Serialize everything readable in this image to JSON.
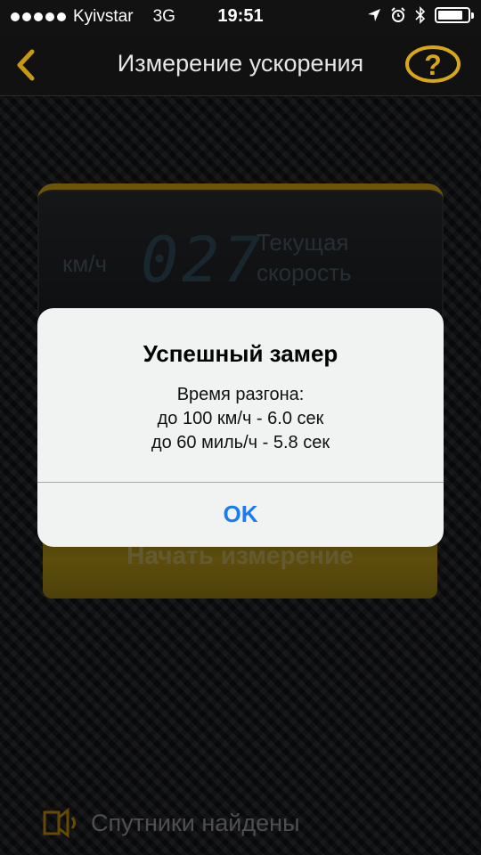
{
  "status_bar": {
    "carrier": "Kyivstar",
    "network": "3G",
    "time": "19:51",
    "battery_level": 0.85,
    "icons": [
      "location-arrow-icon",
      "alarm-clock-icon",
      "bluetooth-icon",
      "battery-icon"
    ]
  },
  "nav": {
    "title": "Измерение ускорения",
    "back_icon": "chevron-left-icon",
    "help_icon": "question-icon"
  },
  "speed_panel": {
    "unit": "км/ч",
    "value": "027",
    "caption_line1": "Текущая",
    "caption_line2": "скорость"
  },
  "start_button": {
    "label": "Начать измерение"
  },
  "footer": {
    "satellites_label": "Спутники найдены",
    "satellites_icon": "satellite-signal-icon"
  },
  "alert": {
    "title": "Успешный замер",
    "message_line1": "Время разгона:",
    "message_line2": "до 100 км/ч - 6.0 сек",
    "message_line3": "до 60 миль/ч - 5.8 сек",
    "ok_label": "OK"
  },
  "colors": {
    "accent_gold": "#c59a12",
    "alert_button_blue": "#1a7cf2"
  }
}
